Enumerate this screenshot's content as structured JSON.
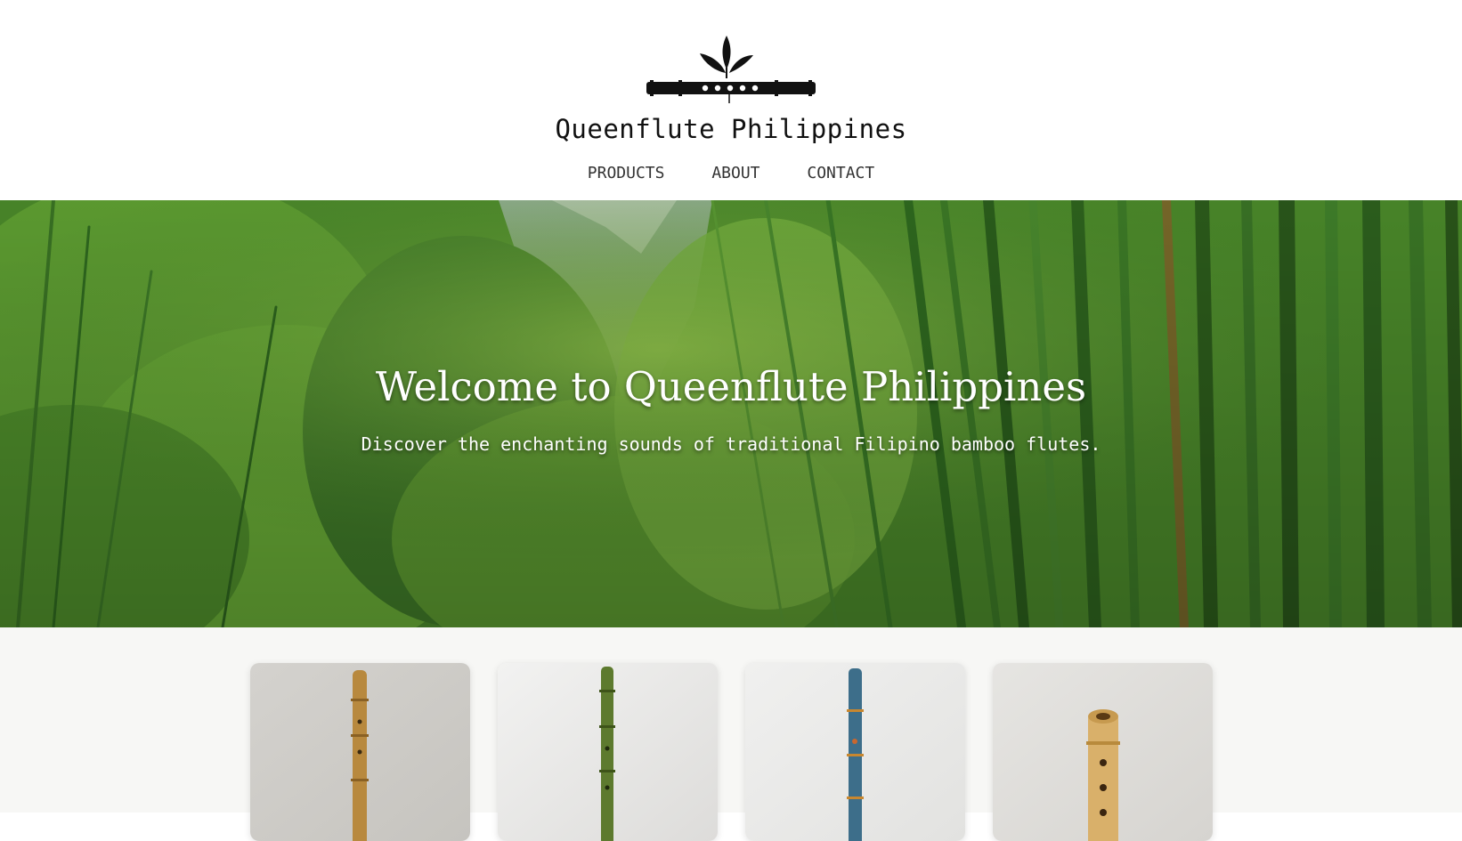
{
  "site": {
    "title": "Queenflute Philippines"
  },
  "nav": {
    "items": [
      "PRODUCTS",
      "ABOUT",
      "CONTACT"
    ]
  },
  "hero": {
    "title": "Welcome to Queenflute Philippines",
    "subtitle": "Discover the enchanting sounds of traditional Filipino bamboo flutes."
  },
  "products": {
    "cards": [
      {
        "image": "tan-bamboo-flute",
        "color": "#b8893e"
      },
      {
        "image": "green-bamboo-flute",
        "color": "#5d7a2e"
      },
      {
        "image": "blue-bamboo-flute",
        "color": "#3d6e8a"
      },
      {
        "image": "light-bamboo-flute",
        "color": "#d9b06a"
      }
    ]
  },
  "colors": {
    "hero_green": "#4e8a2c",
    "section_background": "#f7f7f5"
  }
}
